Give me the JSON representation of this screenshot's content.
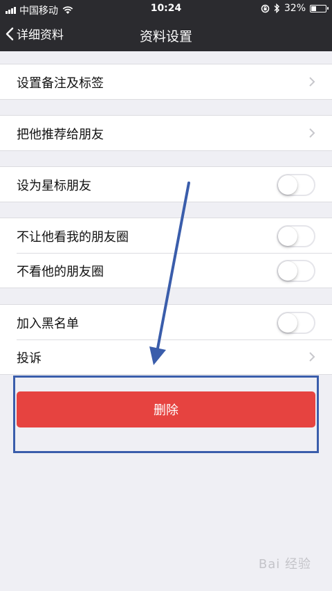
{
  "status_bar": {
    "carrier": "中国移动",
    "time": "10:24",
    "battery_percent": "32%",
    "battery_level": 0.32,
    "icons": [
      "signal-icon",
      "wifi-icon",
      "orientation-lock-icon",
      "bluetooth-icon",
      "battery-icon"
    ]
  },
  "nav": {
    "back_label": "详细资料",
    "title": "资料设置"
  },
  "groups": [
    {
      "items": [
        {
          "label": "设置备注及标签",
          "control": "chevron"
        }
      ]
    },
    {
      "items": [
        {
          "label": "把他推荐给朋友",
          "control": "chevron"
        }
      ]
    },
    {
      "items": [
        {
          "label": "设为星标朋友",
          "control": "switch",
          "on": false
        }
      ]
    },
    {
      "items": [
        {
          "label": "不让他看我的朋友圈",
          "control": "switch",
          "on": false
        },
        {
          "label": "不看他的朋友圈",
          "control": "switch",
          "on": false
        }
      ]
    },
    {
      "items": [
        {
          "label": "加入黑名单",
          "control": "switch",
          "on": false
        },
        {
          "label": "投诉",
          "control": "chevron"
        }
      ]
    }
  ],
  "delete_button": {
    "label": "删除"
  },
  "watermark": "Bai 经验",
  "colors": {
    "nav_bg": "#2b2b2f",
    "page_bg": "#efeff4",
    "delete_red": "#e64340",
    "annotation_blue": "#3a5dab"
  }
}
